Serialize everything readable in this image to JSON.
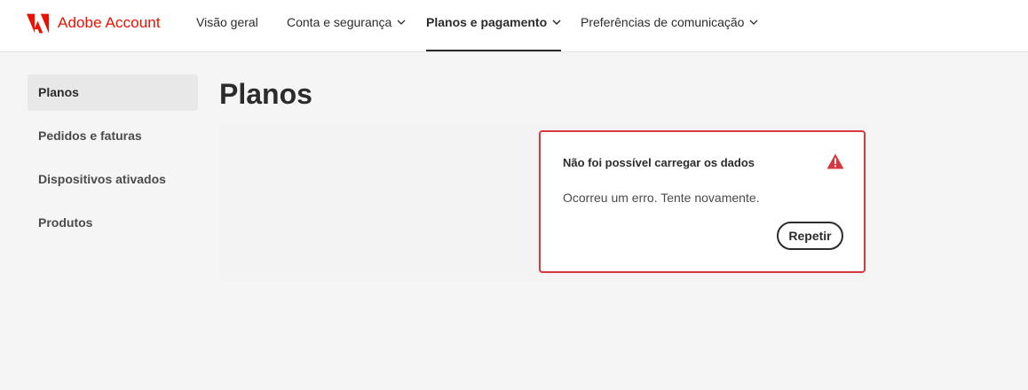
{
  "header": {
    "brand": {
      "name": "Adobe Account",
      "logo_icon": "adobe-logo-icon",
      "color": "#eb1000"
    },
    "nav": [
      {
        "label": "Visão geral",
        "has_dropdown": false,
        "active": false
      },
      {
        "label": "Conta e segurança",
        "has_dropdown": true,
        "active": false
      },
      {
        "label": "Planos e pagamento",
        "has_dropdown": true,
        "active": true
      },
      {
        "label": "Preferências de comunicação",
        "has_dropdown": true,
        "active": false
      }
    ]
  },
  "sidebar": {
    "items": [
      {
        "label": "Planos",
        "selected": true
      },
      {
        "label": "Pedidos e faturas",
        "selected": false
      },
      {
        "label": "Dispositivos ativados",
        "selected": false
      },
      {
        "label": "Produtos",
        "selected": false
      }
    ]
  },
  "main": {
    "title": "Planos",
    "error": {
      "title": "Não foi possível carregar os dados",
      "message": "Ocorreu um erro. Tente novamente.",
      "icon": "alert-triangle-icon",
      "retry_label": "Repetir",
      "accent": "#d7373f"
    }
  }
}
